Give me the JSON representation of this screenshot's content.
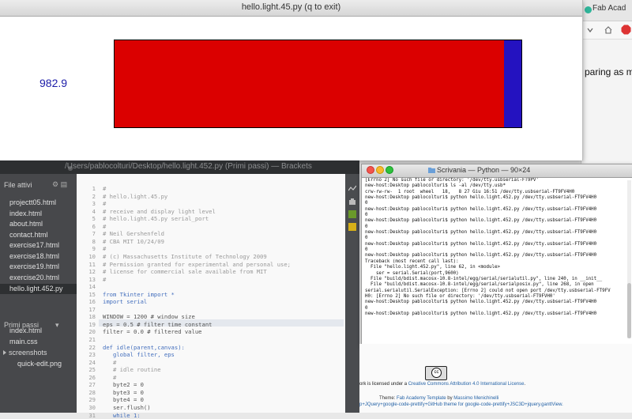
{
  "browser": {
    "tab_label": "Fab Acad",
    "content_fragment": "paring as m"
  },
  "tk_window": {
    "title": "hello.light.45.py (q to exit)",
    "value": "982.9",
    "bar_fraction": 0.958,
    "colors": {
      "fill": "#db0000",
      "background": "#2412c0"
    }
  },
  "brackets": {
    "title": "/Users/pablocolturi/Desktop/hello.light.452.py (Primi passi) — Brackets",
    "working_files_header": "File attivi",
    "working_files": [
      "projectt05.html",
      "index.html",
      "about.html",
      "contact.html",
      "exercise17.html",
      "exercise18.html",
      "exercise19.html",
      "exercise20.html",
      "hello.light.452.py"
    ],
    "selected_file": "hello.light.452.py",
    "project_header": "Primi passi",
    "project_files": [
      "index.html",
      "main.css"
    ],
    "folder": "screenshots",
    "folder_files": [
      "quick-edit.png"
    ],
    "line_numbers": [
      "1",
      "2",
      "3",
      "4",
      "5",
      "6",
      "7",
      "8",
      "9",
      "10",
      "11",
      "12",
      "13",
      "14",
      "15",
      "16",
      "17",
      "18",
      "19",
      "20",
      "21",
      "22",
      "23",
      "24",
      "25",
      "26",
      "27",
      "28",
      "29",
      "30",
      "31"
    ],
    "code_lines": [
      "#",
      "# hello.light.45.py",
      "#",
      "# receive and display light level",
      "# hello.light.45.py serial_port",
      "#",
      "# Neil Gershenfeld",
      "# CBA MIT 10/24/09",
      "#",
      "# (c) Massachusetts Institute of Technology 2009",
      "# Permission granted for experimental and personal use;",
      "# license for commercial sale available from MIT",
      "#",
      "",
      "from Tkinter import *",
      "import serial",
      "",
      "WINDOW = 1200 # window size",
      "eps = 0.5 # filter time constant",
      "filter = 0.0 # filtered value",
      "",
      "def idle(parent,canvas):",
      "   global filter, eps",
      "   #",
      "   # idle routine",
      "   #",
      "   byte2 = 0",
      "   byte3 = 0",
      "   byte4 = 0",
      "   ser.flush()",
      "   while 1:"
    ]
  },
  "terminal": {
    "title": "Scrivania — Python — 90×24",
    "lines": [
      "[Errno 2] No such file or directory: '/dev/tty.usbserial-FT9PV'",
      "new-host:Desktop pablocolturi$ ls -al /dev/tty.usb*",
      "crw-rw-rw-  1 root  wheel   18,   8 27 Giu 16:51 /dev/tty.usbserial-FT9FV4H0",
      "new-host:Desktop pablocolturi$ python hello.light.452.py /dev/tty.usbserial-FT9FV4H0",
      "0",
      "new-host:Desktop pablocolturi$ python hello.light.452.py /dev/tty.usbserial-FT9FV4H0",
      "0",
      "new-host:Desktop pablocolturi$ python hello.light.452.py /dev/tty.usbserial-FT9FV4H0",
      "0",
      "new-host:Desktop pablocolturi$ python hello.light.452.py /dev/tty.usbserial-FT9FV4H0",
      "0",
      "new-host:Desktop pablocolturi$ python hello.light.452.py /dev/tty.usbserial-FT9FV4H0",
      "0",
      "new-host:Desktop pablocolturi$ python hello.light.452.py /dev/tty.usbserial-FT9FV4H0",
      "Traceback (most recent call last):",
      "  File \"hello.light.452.py\", line 62, in <module>",
      "    ser = serial.Serial(port,9600)",
      "  File \"build/bdist.macosx-10.8-intel/egg/serial/serialutil.py\", line 240, in __init__",
      "  File \"build/bdist.macosx-10.8-intel/egg/serial/serialposix.py\", line 268, in open",
      "serial.serialutil.SerialException: [Errno 2] could not open port /dev/tty.usbserial-FT9FV",
      "H0: [Errno 2] No such file or directory: '/dev/tty.usbserial-FT9FVH0'",
      "new-host:Desktop pablocolturi$ python hello.light.452.py /dev/tty.usbserial-FT9FV4H0",
      "0",
      "new-host:Desktop pablocolturi$ python hello.light.452.py /dev/tty.usbserial-FT9FV4H0"
    ]
  },
  "footer": {
    "license_prefix": "ork is licensed under a ",
    "license_link": "Creative Commons Attribution 4.0 International License",
    "license_suffix": ".",
    "theme_prefix": "Theme: ",
    "theme_link1": "Fab Academy Template",
    "theme_mid": " by ",
    "theme_author": "Massimo Menichinelli",
    "credits": "p+JQuery+google-code-prettify+GitHub theme for google-code-prettify+JSC3D+jquery.ganttView."
  }
}
